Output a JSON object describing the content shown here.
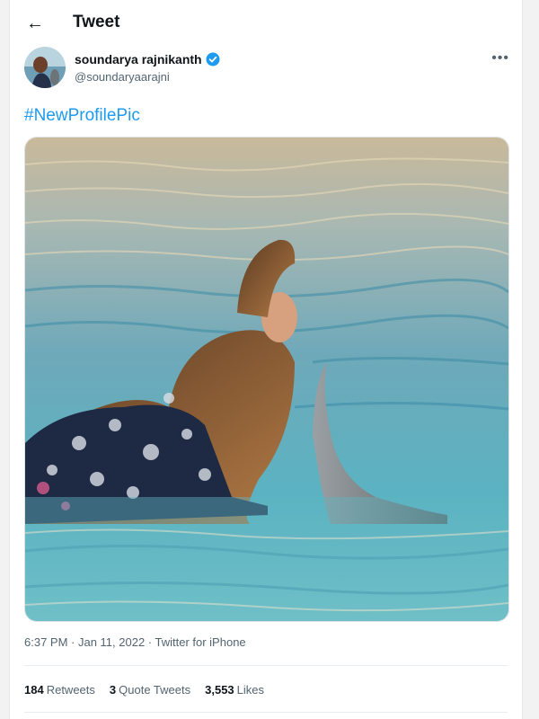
{
  "header": {
    "back_icon": "back-arrow-icon",
    "title": "Tweet"
  },
  "tweet": {
    "display_name": "soundarya rajnikanth",
    "verified_icon": "verified-badge-icon",
    "handle": "@soundaryaarajni",
    "more_icon": "more-options-icon",
    "text": "#NewProfilePic",
    "timestamp": "6:37 PM · Jan 11, 2022 · Twitter for iPhone"
  },
  "stats": {
    "retweets_count": "184",
    "retweets_label": "Retweets",
    "quotes_count": "3",
    "quotes_label": "Quote Tweets",
    "likes_count": "3,553",
    "likes_label": "Likes"
  },
  "colors": {
    "link": "#1d9bf0",
    "verified": "#1d9bf0",
    "text": "#0f1419",
    "muted": "#536471"
  }
}
